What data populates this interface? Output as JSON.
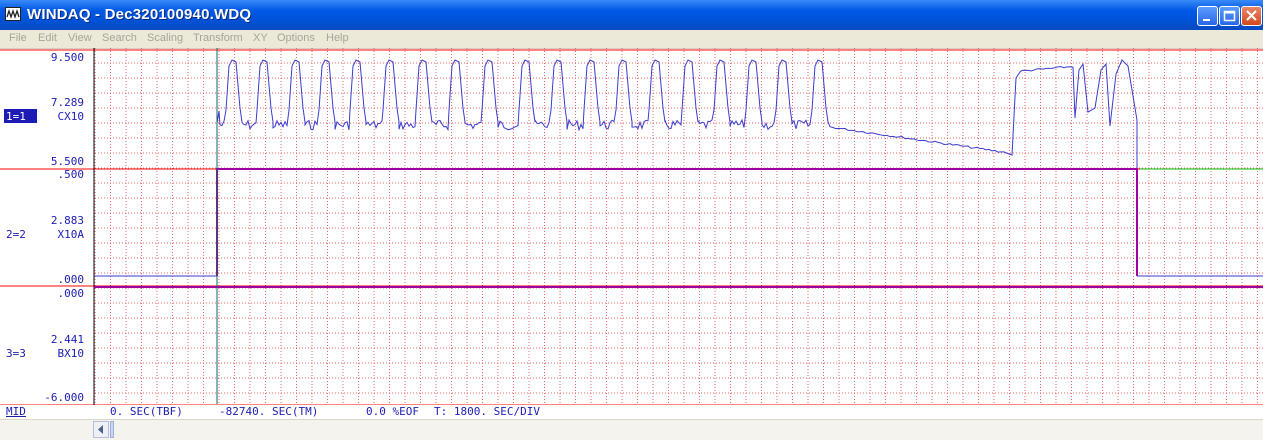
{
  "window": {
    "title": "WINDAQ - Dec320100940.WDQ"
  },
  "menu": {
    "items": [
      "File",
      "Edit",
      "View",
      "Search",
      "Scaling",
      "Transform",
      "XY",
      "Options",
      "Help"
    ]
  },
  "channels": [
    {
      "label": "1=1",
      "name": "CX10",
      "top_value": "9.500",
      "mid_value": "7.289",
      "bottom_value": "5.500",
      "selected": true
    },
    {
      "label": "2=2",
      "name": "X10A",
      "top_value": ".500",
      "mid_value": "2.883",
      "bottom_value": ".000",
      "selected": false
    },
    {
      "label": "3=3",
      "name": "BX10",
      "top_value": ".000",
      "mid_value": "2.441",
      "bottom_value": "-6.000",
      "selected": false
    }
  ],
  "status": {
    "mode": "MID",
    "tbf": "0. SEC(TBF)",
    "tm": "-82740. SEC(TM)",
    "eof": "0.0 %EOF",
    "div": "T: 1800. SEC/DIV"
  },
  "colors": {
    "trace": "#3b3bd0",
    "grid": "#e36a6a",
    "channel_sep": "#ff0000",
    "baseline": "#00c000",
    "step": "#a000a0",
    "cursor": "#0b6a6a",
    "label_text": "#1c1cb4"
  },
  "chart_data": {
    "type": "line",
    "x_division": "1800. SEC/DIV",
    "series": [
      {
        "name": "CX10",
        "ylim": [
          5.5,
          9.5
        ],
        "shape": "periodic pulses oscillating ~7.0 to ~9.3, then a decaying plateau from ~7.0 to ~6.1, a high plateau ~9.1, then pulses"
      },
      {
        "name": "X10A",
        "ylim": [
          0,
          0.5
        ],
        "shape": "step: 0 until cursor, then 0.5, then back to 0"
      },
      {
        "name": "BX10",
        "ylim": [
          -6,
          0
        ],
        "shape": "flat at 0"
      }
    ]
  }
}
